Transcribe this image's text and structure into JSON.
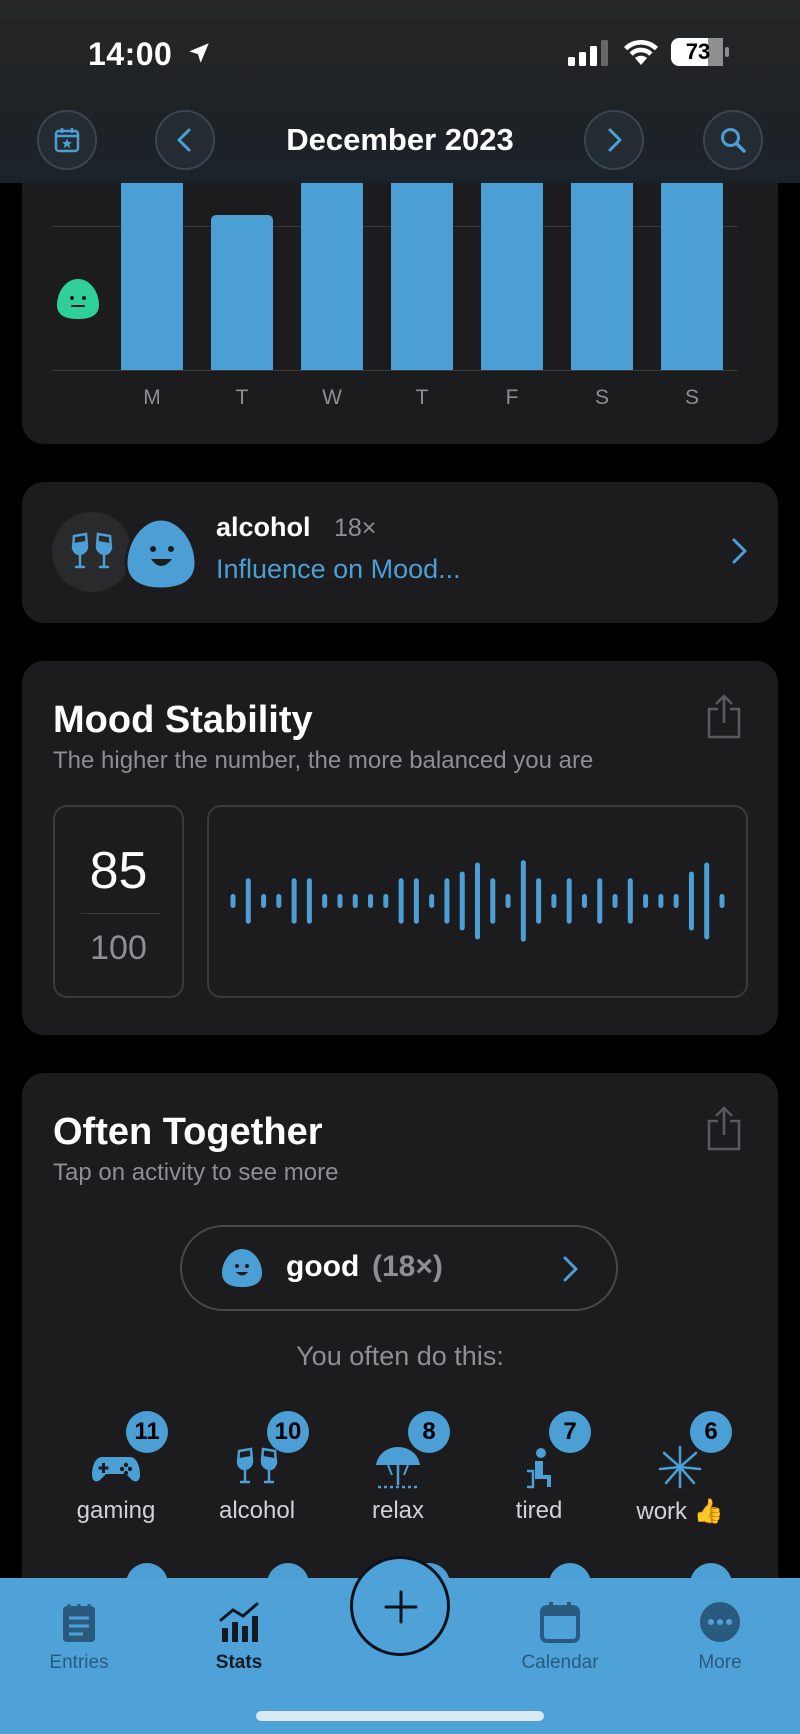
{
  "status_bar": {
    "time": "14:00",
    "battery": "73"
  },
  "header": {
    "title": "December 2023"
  },
  "weekday_chart": {
    "days": [
      "M",
      "T",
      "W",
      "T",
      "F",
      "S",
      "S"
    ],
    "values": [
      0.92,
      0.74,
      0.92,
      1.0,
      0.96,
      1.0,
      1.0
    ],
    "bar_color": "#4b9fd5",
    "face_color": "#2ecf9b"
  },
  "influence": {
    "activity": "alcohol",
    "count": "18×",
    "link": "Influence on Mood..."
  },
  "stability": {
    "title": "Mood Stability",
    "subtitle": "The higher the number, the more balanced you are",
    "score": "85",
    "max": "100",
    "wave": [
      0.1,
      0.45,
      0.1,
      0.1,
      0.45,
      0.45,
      0.1,
      0.1,
      0.1,
      0.1,
      0.1,
      0.45,
      0.45,
      0.1,
      0.45,
      0.6,
      0.8,
      0.45,
      0.1,
      0.85,
      0.45,
      0.1,
      0.45,
      0.1,
      0.45,
      0.1,
      0.45,
      0.1,
      0.1,
      0.1,
      0.6,
      0.8,
      0.1
    ]
  },
  "together": {
    "title": "Often Together",
    "subtitle": "Tap on activity to see more",
    "mood_label": "good",
    "mood_count": "(18×)",
    "prompt": "You often do this:",
    "activities": [
      {
        "label": "gaming",
        "count": "11",
        "icon": "gamepad-icon"
      },
      {
        "label": "alcohol",
        "count": "10",
        "icon": "cheers-icon"
      },
      {
        "label": "relax",
        "count": "8",
        "icon": "beach-umbrella-icon"
      },
      {
        "label": "tired",
        "count": "7",
        "icon": "tired-person-icon"
      },
      {
        "label": "work 👍",
        "count": "6",
        "icon": "fireworks-icon"
      }
    ]
  },
  "tabs": [
    {
      "label": "Entries",
      "icon": "list-icon"
    },
    {
      "label": "Stats",
      "icon": "chart-icon"
    },
    {
      "label": "Calendar",
      "icon": "calendar-icon"
    },
    {
      "label": "More",
      "icon": "more-icon"
    }
  ]
}
